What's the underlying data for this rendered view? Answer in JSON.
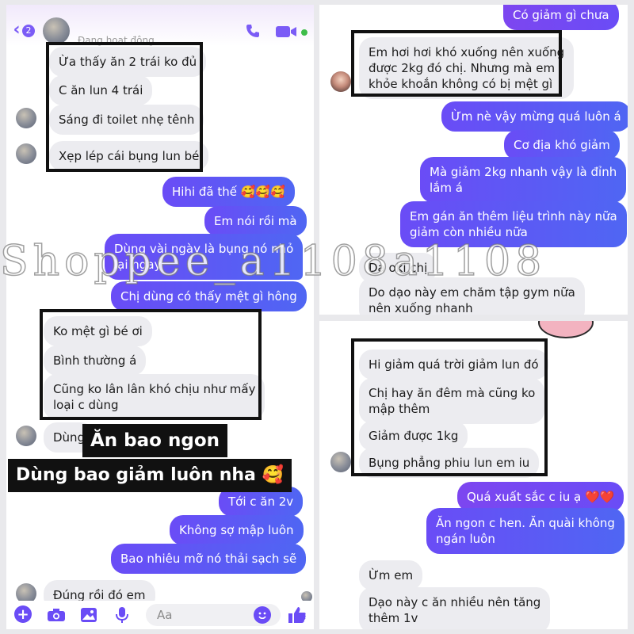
{
  "left": {
    "header": {
      "back_count": "2",
      "status": "Đang hoạt động"
    },
    "messages": [
      "Ừa thấy ăn 2 trái ko đủ",
      "C ăn lun 4 trái",
      "Sáng đi toilet nhẹ tênh",
      "Xẹp lép cái bụng lun bé",
      "Hihi đã thế 🥰🥰🥰",
      "Em nói rồi mà",
      "Dùng vài ngày là bụng nó nhỏ",
      "lại ngay",
      "Chị dùng có thấy mệt gì hông",
      "Ko mệt gì bé ơi",
      "Bình thường á",
      "Cũng ko lân lân khó chịu như mấy",
      "loại c dùng",
      "Dùng",
      "Tới c ăn 2v",
      "Không sợ mập luôn",
      "Bao nhiêu mỡ nó thải sạch sẽ",
      "Đúng rồi đó em"
    ],
    "composer": {
      "placeholder": "Aa"
    }
  },
  "captions": {
    "line1": "Ăn bao ngon",
    "line2": "Dùng bao giảm luôn nha 🥰"
  },
  "watermark": "Shoppee_a1108a1108",
  "top_right": {
    "messages": [
      "Có giảm gì chưa",
      "Em hơi hơi khó xuống nên xuống",
      "được 2kg đó chị. Nhưng mà em",
      "khỏe khoắn không có bị mệt gì",
      "Ừm nè vậy mừng quá luôn á",
      "Cơ địa khó giảm",
      "Mà giảm 2kg nhanh vậy là đỉnh",
      "lắm á",
      "Em gán ăn thêm liệu trình này nữa",
      "giảm còn nhiều nữa",
      "Dạ oki chị",
      "Do dạo này em chăm tập gym nữa",
      "nên xuống nhanh"
    ]
  },
  "bottom_right": {
    "messages": [
      "Hi giảm quá trời giảm lun đó",
      "Chị hay ăn đêm mà cũng ko",
      "mập thêm",
      "Giảm được 1kg",
      "Bụng phẳng phiu lun em iu",
      "Quá xuất sắc c iu ạ ❤️❤️",
      "Ăn ngon c hen. Ăn quài không",
      "ngán luôn",
      "Ừm em",
      "Dạo này c ăn nhiều nên tăng",
      "thêm 1v"
    ]
  },
  "colors": {
    "accent": "#6a4cf6",
    "incoming": "#ececf0",
    "frame": "#111111"
  },
  "icons": [
    "back-icon",
    "phone-icon",
    "video-icon",
    "plus-icon",
    "camera-icon",
    "image-icon",
    "mic-icon",
    "emoji-icon",
    "like-icon"
  ]
}
